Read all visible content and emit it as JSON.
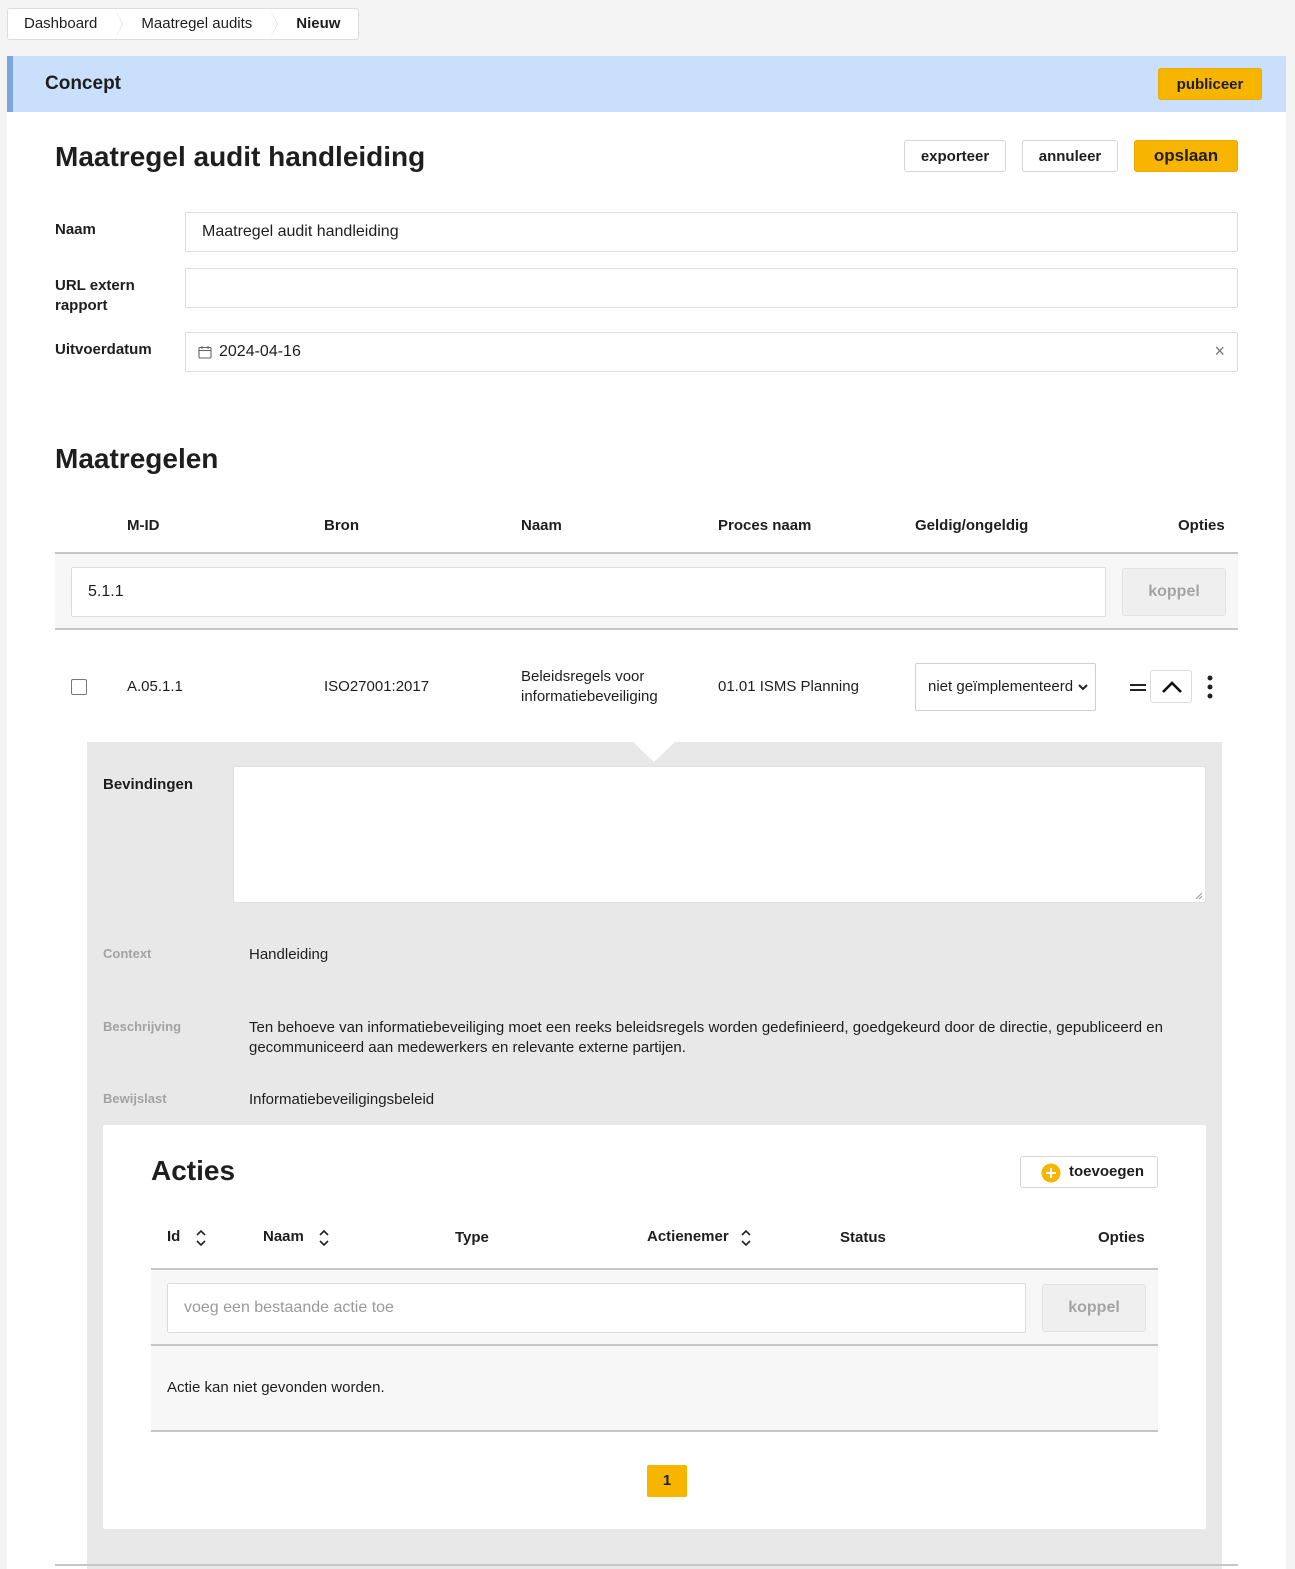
{
  "breadcrumb": [
    "Dashboard",
    "Maatregel audits",
    "Nieuw"
  ],
  "concept": {
    "label": "Concept",
    "publish_label": "publiceer"
  },
  "header": {
    "title": "Maatregel audit handleiding",
    "export_label": "exporteer",
    "cancel_label": "annuleer",
    "save_label": "opslaan"
  },
  "form": {
    "name_label": "Naam",
    "name_value": "Maatregel audit handleiding",
    "url_label": "URL extern rapport",
    "url_value": "",
    "date_label": "Uitvoerdatum",
    "date_value": "2024-04-16"
  },
  "maatregelen": {
    "title": "Maatregelen",
    "columns": [
      "M-ID",
      "Bron",
      "Naam",
      "Proces naam",
      "Geldig/ongeldig",
      "Opties"
    ],
    "link_input_value": "5.1.1",
    "link_button": "koppel",
    "rows": [
      {
        "mid": "A.05.1.1",
        "bron": "ISO27001:2017",
        "naam": "Beleidsregels voor informatiebeveiliging",
        "proces": "01.01 ISMS Planning",
        "status": "niet geïmplementeerd"
      }
    ]
  },
  "detail": {
    "bevindingen_label": "Bevindingen",
    "context_label": "Context",
    "context_value": "Handleiding",
    "beschrijving_label": "Beschrijving",
    "beschrijving_value": "Ten behoeve van informatiebeveiliging moet een reeks beleidsregels worden gedefinieerd, goedgekeurd door de directie, gepubliceerd en gecommuniceerd aan medewerkers en relevante externe partijen.",
    "bewijslast_label": "Bewijslast",
    "bewijslast_value": "Informatiebeveiligingsbeleid"
  },
  "acties": {
    "title": "Acties",
    "add_label": "toevoegen",
    "columns": [
      "Id",
      "Naam",
      "Type",
      "Actienemer",
      "Status",
      "Opties"
    ],
    "link_placeholder": "voeg een bestaande actie toe",
    "link_button": "koppel",
    "empty_text": "Actie kan niet gevonden worden.",
    "page": "1"
  },
  "colors": {
    "accent": "#f7b500",
    "banner": "#c9dffb",
    "banner_edge": "#7ba6db"
  },
  "icons": [
    "calendar-icon",
    "close-icon",
    "chevron-down-icon",
    "drag-handle-icon",
    "chevron-up-icon",
    "kebab-menu-icon",
    "plus-circle-icon",
    "sort-icon"
  ]
}
